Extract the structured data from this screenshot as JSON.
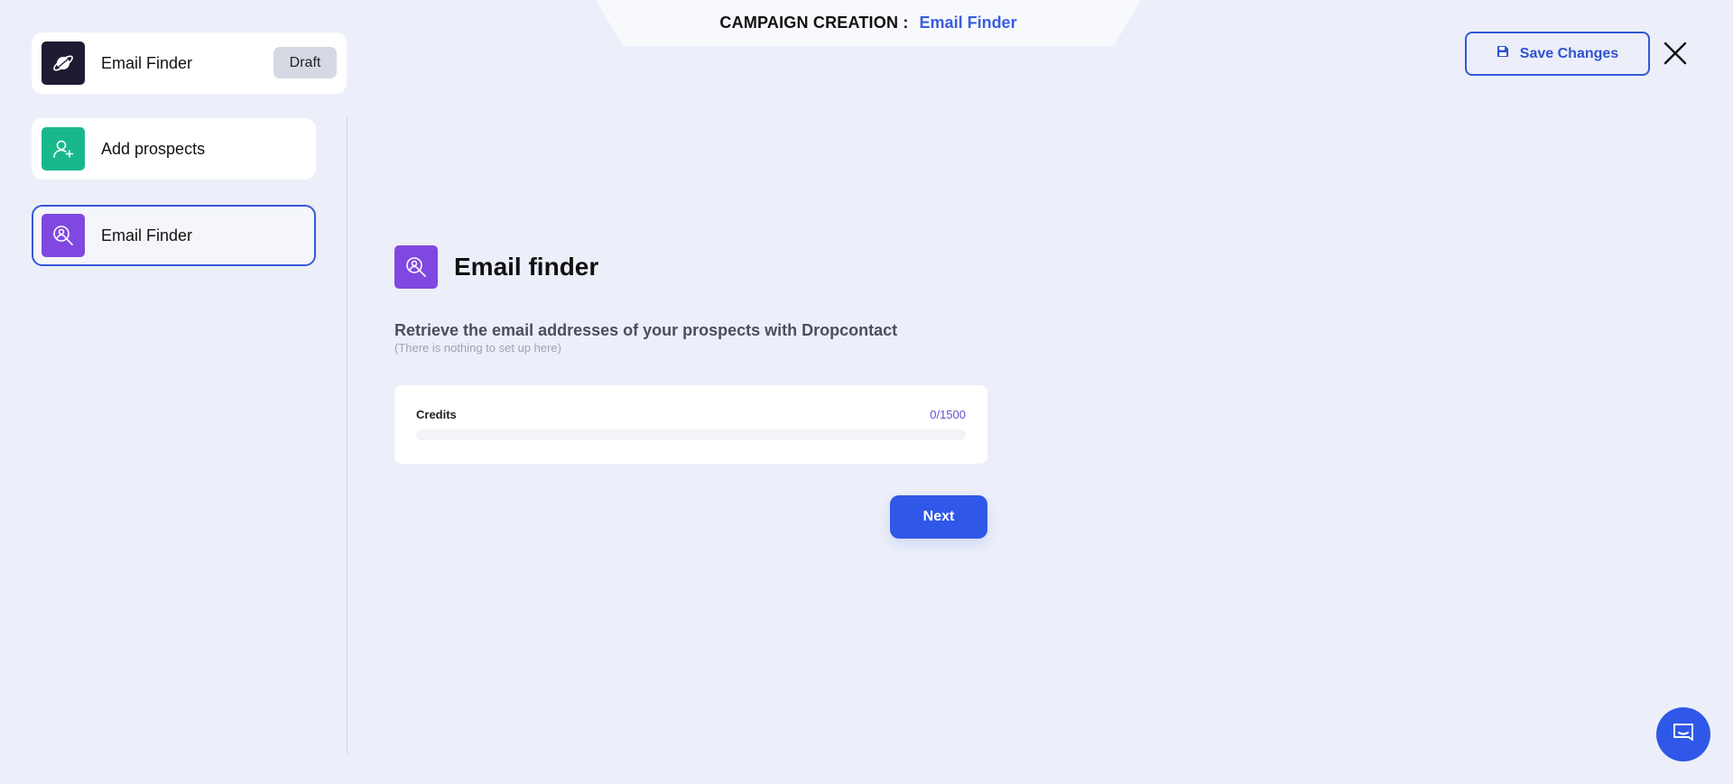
{
  "header": {
    "label": "CAMPAIGN CREATION :",
    "value": "Email Finder"
  },
  "campaign": {
    "name": "Email Finder",
    "status": "Draft",
    "icon": "planet-icon"
  },
  "steps": [
    {
      "label": "Add prospects",
      "icon": "add-user-icon",
      "color": "#19b88b",
      "active": false
    },
    {
      "label": "Email Finder",
      "icon": "user-search-icon",
      "color": "#8048e0",
      "active": true
    }
  ],
  "toolbar": {
    "save_label": "Save Changes"
  },
  "main": {
    "title": "Email finder",
    "description": "Retrieve the email addresses of your prospects with Dropcontact",
    "subdescription": "(There is nothing to set up here)",
    "credits": {
      "label": "Credits",
      "value": "0/1500",
      "used_fraction": 0
    },
    "next_label": "Next"
  },
  "colors": {
    "accent": "#2f58e8",
    "background": "#eceff9"
  }
}
